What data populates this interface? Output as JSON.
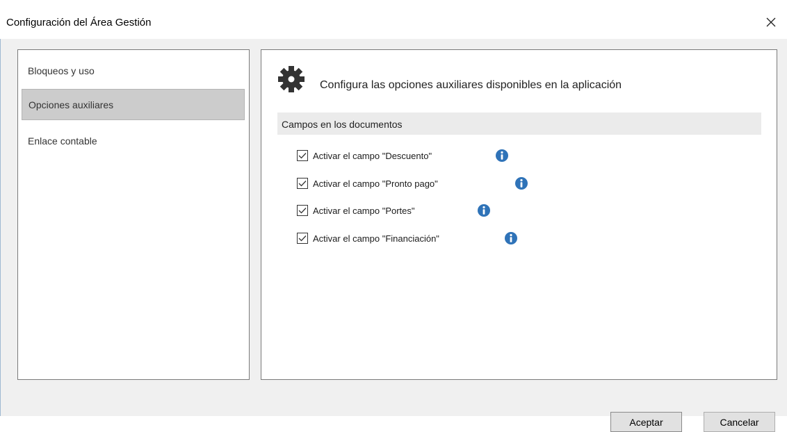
{
  "window": {
    "title": "Configuración del Área Gestión",
    "close_icon": "close-icon"
  },
  "sidebar": {
    "items": [
      {
        "label": "Bloqueos y uso",
        "selected": false
      },
      {
        "label": "Opciones auxiliares",
        "selected": true
      },
      {
        "label": "Enlace contable",
        "selected": false
      }
    ]
  },
  "main": {
    "icon": "gear-icon",
    "heading": "Configura las opciones auxiliares disponibles en la aplicación",
    "section_title": "Campos en los documentos",
    "options": [
      {
        "label": "Activar el campo \"Descuento\"",
        "checked": true,
        "info_icon": "info-icon"
      },
      {
        "label": "Activar el campo \"Pronto pago\"",
        "checked": true,
        "info_icon": "info-icon"
      },
      {
        "label": "Activar el campo \"Portes\"",
        "checked": true,
        "info_icon": "info-icon"
      },
      {
        "label": "Activar el campo \"Financiación\"",
        "checked": true,
        "info_icon": "info-icon"
      }
    ]
  },
  "footer": {
    "ok_label": "Aceptar",
    "cancel_label": "Cancelar"
  },
  "colors": {
    "info_blue": "#2f73b8",
    "selected_bg": "#cccccc",
    "section_bg": "#ebebeb",
    "client_bg": "#f0f0f0"
  }
}
